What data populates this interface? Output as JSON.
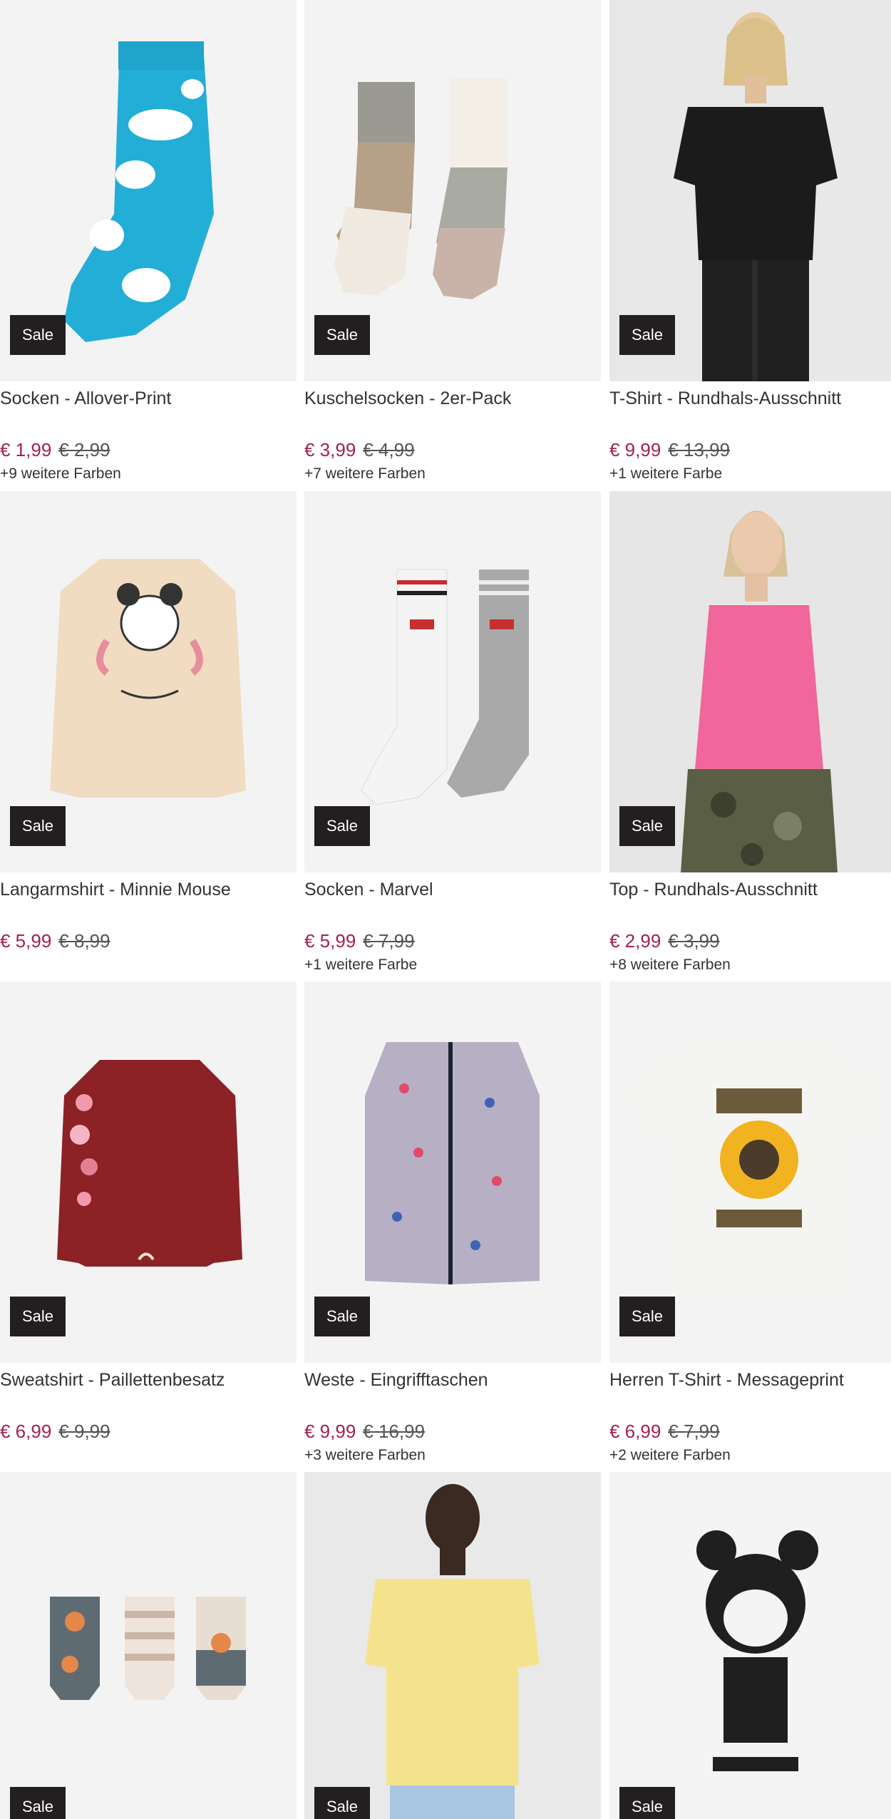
{
  "badge": "Sale",
  "colors": {
    "sale_bg": "#231f20",
    "price_new": "#a4224e",
    "image_bg": "#f3f3f3"
  },
  "products": [
    {
      "name": "Socken - Allover-Print",
      "price": "€ 1,99",
      "old_price": "€ 2,99",
      "colors": "+9 weitere Farben",
      "image": "blue-cloud-sock"
    },
    {
      "name": "Kuschelsocken - 2er-Pack",
      "price": "€ 3,99",
      "old_price": "€ 4,99",
      "colors": "+7 weitere Farben",
      "image": "fuzzy-socks"
    },
    {
      "name": "T-Shirt - Rundhals-Ausschnitt",
      "price": "€ 9,99",
      "old_price": "€ 13,99",
      "colors": "+1 weitere Farbe",
      "image": "black-tshirt-model"
    },
    {
      "name": "Langarmshirt - Minnie Mouse",
      "price": "€ 5,99",
      "old_price": "€ 8,99",
      "colors": "",
      "image": "minnie-longsleeve"
    },
    {
      "name": "Socken - Marvel",
      "price": "€ 5,99",
      "old_price": "€ 7,99",
      "colors": "+1 weitere Farbe",
      "image": "marvel-socks"
    },
    {
      "name": "Top - Rundhals-Ausschnitt",
      "price": "€ 2,99",
      "old_price": "€ 3,99",
      "colors": "+8 weitere Farben",
      "image": "pink-top-model"
    },
    {
      "name": "Sweatshirt - Paillettenbesatz",
      "price": "€ 6,99",
      "old_price": "€ 9,99",
      "colors": "",
      "image": "red-sweatshirt"
    },
    {
      "name": "Weste - Eingrifftaschen",
      "price": "€ 9,99",
      "old_price": "€ 16,99",
      "colors": "+3 weitere Farben",
      "image": "floral-vest"
    },
    {
      "name": "Herren T-Shirt - Messageprint",
      "price": "€ 6,99",
      "old_price": "€ 7,99",
      "colors": "+2 weitere Farben",
      "image": "print-tshirt"
    },
    {
      "name": "",
      "price": "",
      "old_price": "",
      "colors": "",
      "image": "fox-socks"
    },
    {
      "name": "",
      "price": "",
      "old_price": "",
      "colors": "",
      "image": "yellow-tshirt-model"
    },
    {
      "name": "",
      "price": "",
      "old_price": "",
      "colors": "",
      "image": "mickey-tshirt"
    }
  ]
}
